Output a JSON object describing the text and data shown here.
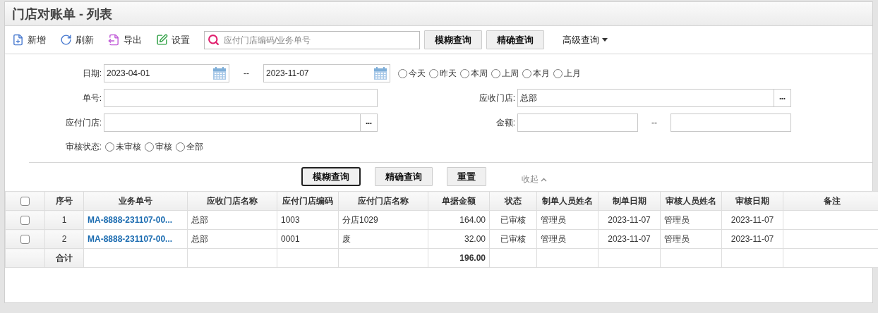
{
  "title": "门店对账单 - 列表",
  "toolbar": {
    "actions": [
      {
        "kind": "add",
        "label": "新增"
      },
      {
        "kind": "refresh",
        "label": "刷新"
      },
      {
        "kind": "export",
        "label": "导出"
      },
      {
        "kind": "settings",
        "label": "设置"
      }
    ],
    "search": {
      "placeholder": "应付门店编码/业务单号"
    },
    "buttons": [
      "模糊查询",
      "精确查询"
    ],
    "advanced": "高级查询"
  },
  "filters": {
    "date": {
      "label": "日期:",
      "from": "2023-04-01",
      "separator": "--",
      "to": "2023-11-07",
      "ranges": [
        {
          "label": "今天",
          "selected": false
        },
        {
          "label": "昨天",
          "selected": false
        },
        {
          "label": "本周",
          "selected": false
        },
        {
          "label": "上周",
          "selected": false
        },
        {
          "label": "本月",
          "selected": false
        },
        {
          "label": "上月",
          "selected": false
        }
      ]
    },
    "order_no": {
      "label": "单号:"
    },
    "receiving_store": {
      "label": "应收门店:",
      "value": "总部",
      "picker": "•••"
    },
    "paying_store": {
      "label": "应付门店:",
      "picker": "•••"
    },
    "amount": {
      "label": "金额:",
      "separator": "--"
    },
    "audit_status": {
      "label": "审核状态:",
      "options": [
        {
          "label": "未审核",
          "selected": false
        },
        {
          "label": "审核",
          "selected": false
        },
        {
          "label": "全部",
          "selected": false
        }
      ]
    }
  },
  "form_buttons": [
    {
      "label": "模糊查询",
      "focused": true
    },
    {
      "label": "精确查询",
      "focused": false
    },
    {
      "label": "重置",
      "focused": false
    }
  ],
  "collapse": "收起",
  "table": {
    "columns": [
      "序号",
      "业务单号",
      "应收门店名称",
      "应付门店编码",
      "应付门店名称",
      "单据金额",
      "状态",
      "制单人员姓名",
      "制单日期",
      "审核人员姓名",
      "审核日期",
      "备注"
    ],
    "all_checked": false,
    "rows": [
      {
        "checked": false,
        "cells": [
          "1",
          "MA-8888-231107-00...",
          "总部",
          "1003",
          "分店1029",
          "164.00",
          "已审核",
          "管理员",
          "2023-11-07",
          "管理员",
          "2023-11-07"
        ]
      },
      {
        "checked": false,
        "cells": [
          "2",
          "MA-8888-231107-00...",
          "总部",
          "0001",
          "废",
          "32.00",
          "已审核",
          "管理员",
          "2023-11-07",
          "管理员",
          "2023-11-07"
        ]
      }
    ],
    "total": {
      "label": "合计",
      "amount": "196.00"
    }
  }
}
